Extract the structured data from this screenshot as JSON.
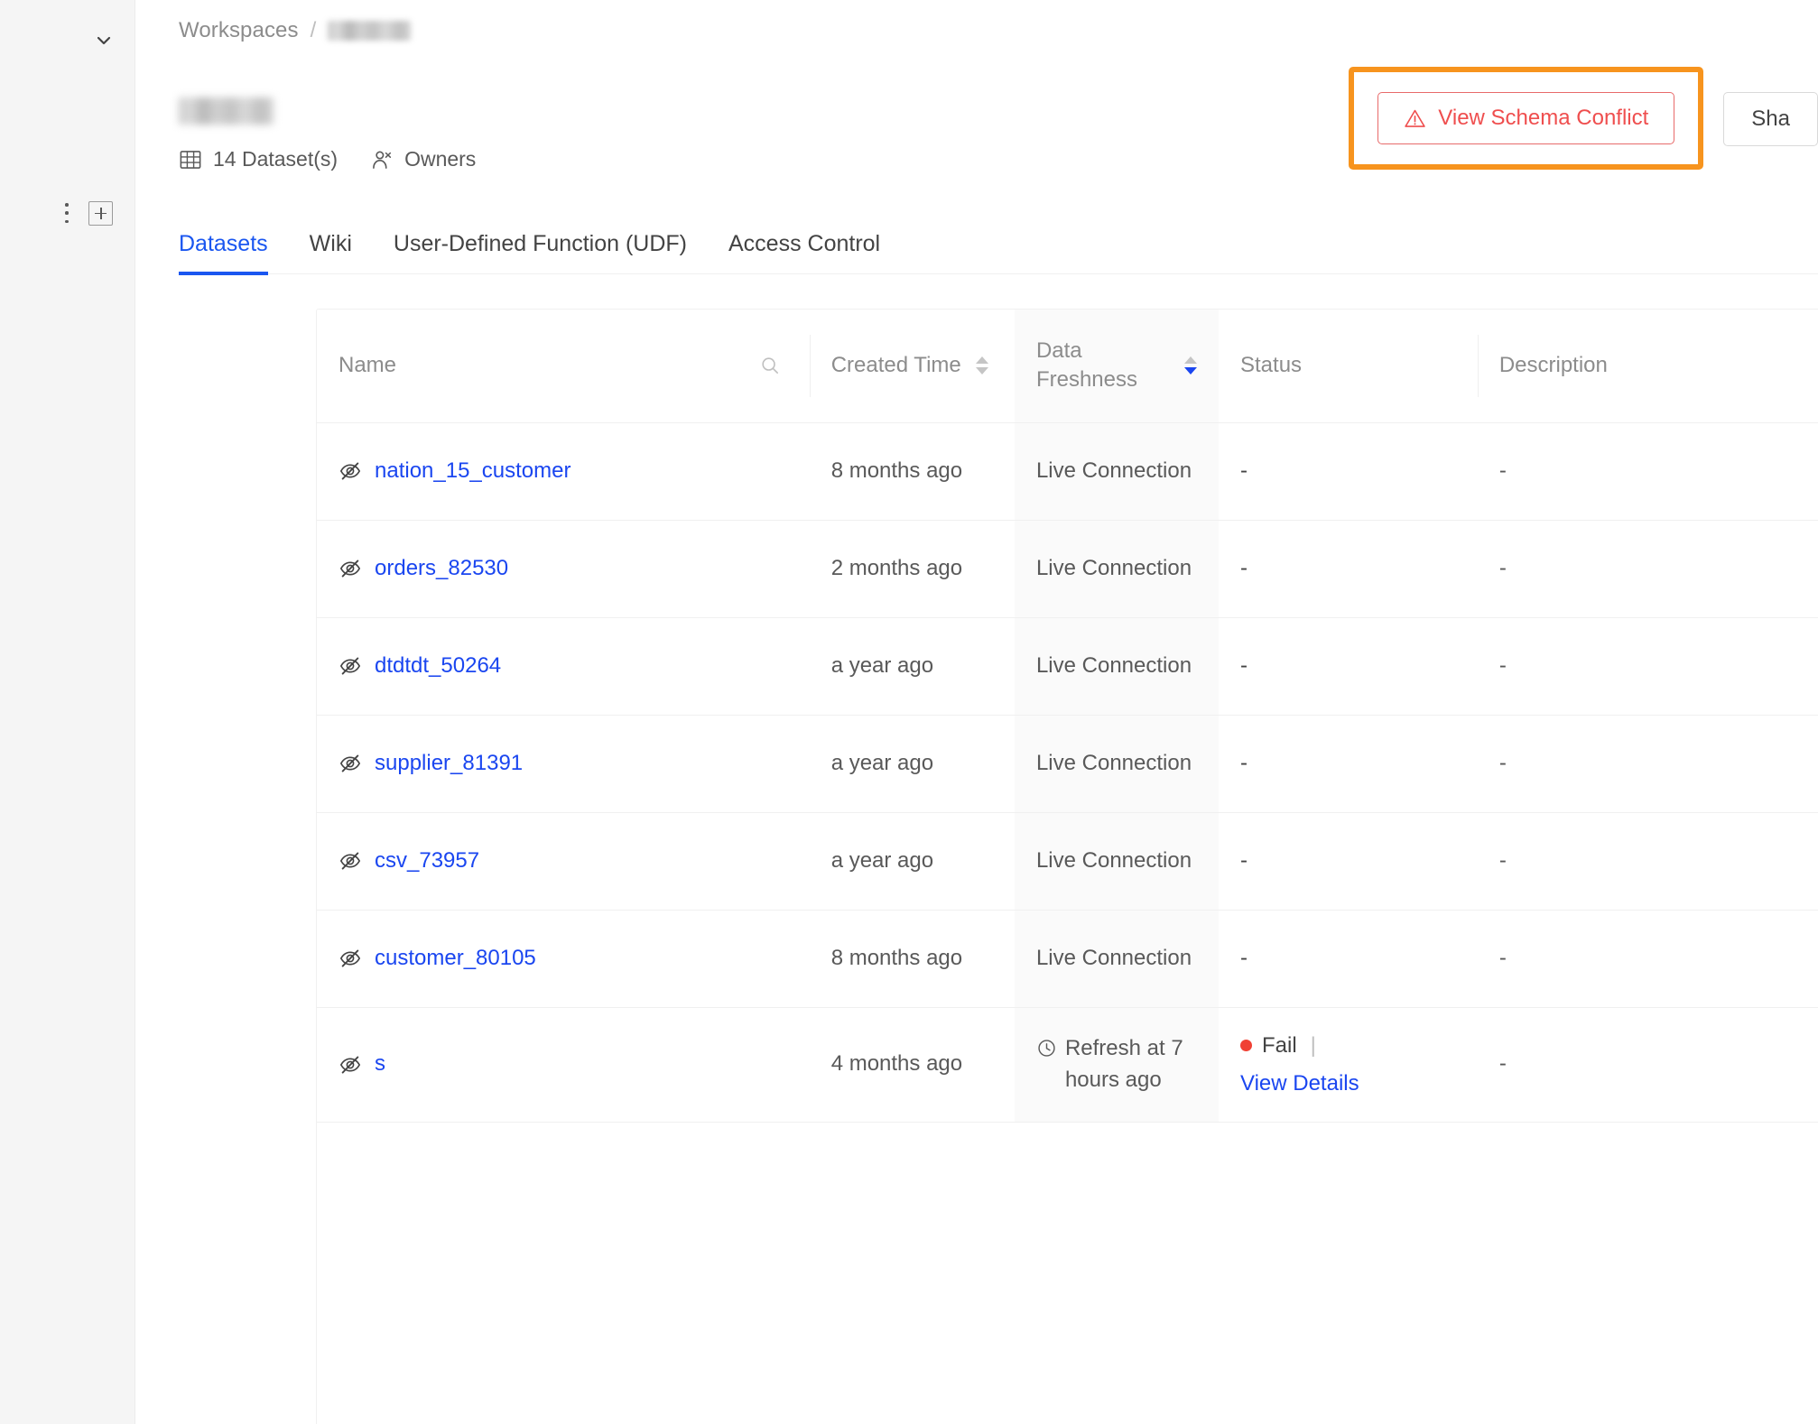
{
  "sidebar": {
    "collapse_icon": "chevron-down-icon",
    "more_icon": "more-vertical-icon",
    "add_icon": "plus-square-icon"
  },
  "breadcrumb": {
    "root": "Workspaces",
    "separator": "/",
    "current": ""
  },
  "page": {
    "title": "",
    "dataset_count_label": "14 Dataset(s)",
    "owners_label": "Owners",
    "table_icon": "table-grid-icon",
    "owners_icon": "team-icon"
  },
  "header": {
    "conflict_button": "View Schema Conflict",
    "conflict_icon": "warning-triangle-icon",
    "share_button": "Sha",
    "highlight_color": "#f7941e",
    "conflict_color": "#ef4e4e"
  },
  "tabs": [
    {
      "label": "Datasets",
      "active": true
    },
    {
      "label": "Wiki",
      "active": false
    },
    {
      "label": "User-Defined Function (UDF)",
      "active": false
    },
    {
      "label": "Access Control",
      "active": false
    }
  ],
  "table": {
    "columns": [
      {
        "key": "name",
        "label": "Name",
        "search_icon": "search-icon"
      },
      {
        "key": "created_time",
        "label": "Created Time",
        "sortable": true,
        "sort": "none"
      },
      {
        "key": "data_freshness",
        "label": "Data Freshness",
        "sortable": true,
        "sort": "desc"
      },
      {
        "key": "status",
        "label": "Status"
      },
      {
        "key": "description",
        "label": "Description"
      }
    ],
    "rows": [
      {
        "icon": "eye-invisible-icon",
        "name": "nation_15_customer",
        "created_time": "8 months ago",
        "data_freshness": "Live Connection",
        "freshness_icon": "",
        "status": "-",
        "status_detail": "",
        "description": "-"
      },
      {
        "icon": "eye-invisible-icon",
        "name": "orders_82530",
        "created_time": "2 months ago",
        "data_freshness": "Live Connection",
        "freshness_icon": "",
        "status": "-",
        "status_detail": "",
        "description": "-"
      },
      {
        "icon": "eye-invisible-icon",
        "name": "dtdtdt_50264",
        "created_time": "a year ago",
        "data_freshness": "Live Connection",
        "freshness_icon": "",
        "status": "-",
        "status_detail": "",
        "description": "-"
      },
      {
        "icon": "eye-invisible-icon",
        "name": "supplier_81391",
        "created_time": "a year ago",
        "data_freshness": "Live Connection",
        "freshness_icon": "",
        "status": "-",
        "status_detail": "",
        "description": "-"
      },
      {
        "icon": "eye-invisible-icon",
        "name": "csv_73957",
        "created_time": "a year ago",
        "data_freshness": "Live Connection",
        "freshness_icon": "",
        "status": "-",
        "status_detail": "",
        "description": "-"
      },
      {
        "icon": "eye-invisible-icon",
        "name": "customer_80105",
        "created_time": "8 months ago",
        "data_freshness": "Live Connection",
        "freshness_icon": "",
        "status": "-",
        "status_detail": "",
        "description": "-"
      },
      {
        "icon": "eye-invisible-icon",
        "name": "s",
        "created_time": "4 months ago",
        "data_freshness": "Refresh at 7 hours ago",
        "freshness_icon": "clock-icon",
        "status": "Fail",
        "status_detail": "View Details",
        "description": "-"
      }
    ]
  },
  "colors": {
    "link": "#1a46f0",
    "tab_active": "#1a56f0",
    "fail": "#f04134",
    "freshness_column_bg": "#fafafa"
  }
}
